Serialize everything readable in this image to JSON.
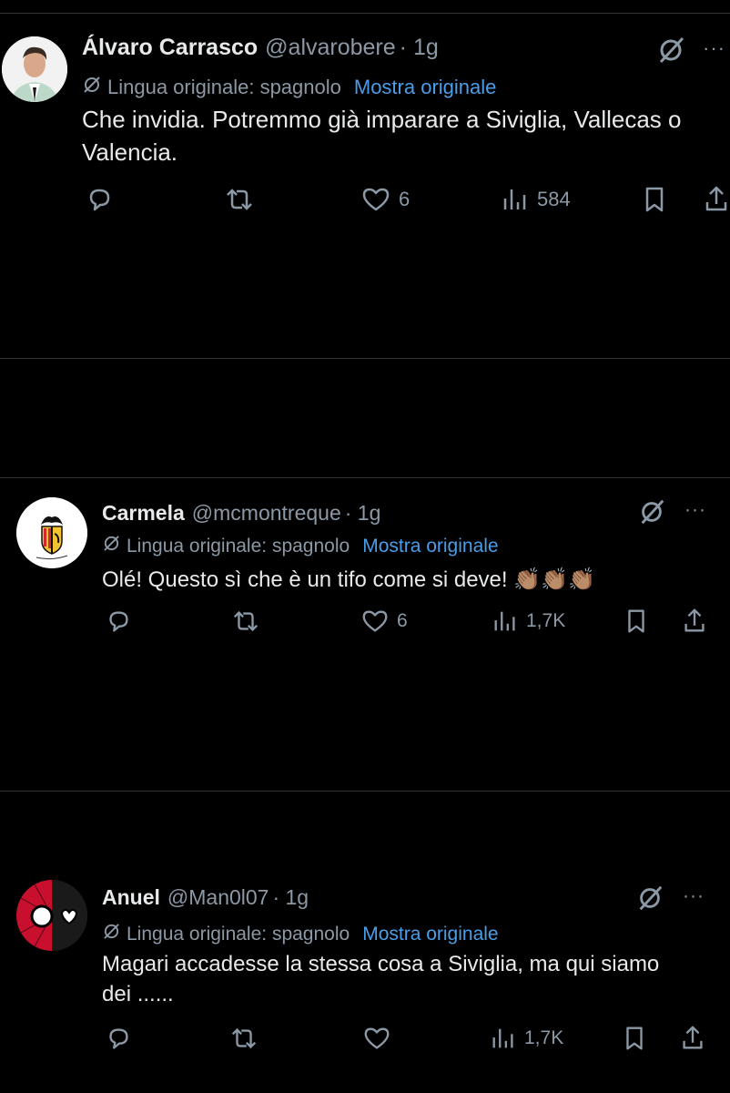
{
  "tweets": [
    {
      "name": "Álvaro Carrasco",
      "handle": "@alvarobere",
      "time": "· 1g",
      "translated_label": "Lingua originale: spagnolo",
      "show_original": "Mostra originale",
      "text": "Che invidia. Potremmo già imparare a Siviglia, Vallecas o Valencia.",
      "likes": "6",
      "views": "584",
      "avatar_icon": "profile-photo"
    },
    {
      "name": "Carmela",
      "handle": "@mcmontreque",
      "time": "· 1g",
      "translated_label": "Lingua originale: spagnolo",
      "show_original": "Mostra originale",
      "text": "Olé! Questo sì che è un tifo come si deve! 👏🏽👏🏽👏🏽",
      "likes": "6",
      "views": "1,7K",
      "avatar_icon": "valencia-crest"
    },
    {
      "name": "Anuel",
      "handle": "@Man0l07",
      "time": "· 1g",
      "translated_label": "Lingua originale: spagnolo",
      "show_original": "Mostra originale",
      "text": "Magari accadesse la stessa cosa a Siviglia, ma qui siamo dei ......",
      "likes": "",
      "views": "1,7K",
      "avatar_icon": "spider-man-avatar"
    }
  ],
  "more_label": "···",
  "colors": {
    "background": "#000000",
    "text": "#e7e9ea",
    "secondary": "#8b98a5",
    "link": "#4a9de8",
    "divider": "#2f3336"
  }
}
